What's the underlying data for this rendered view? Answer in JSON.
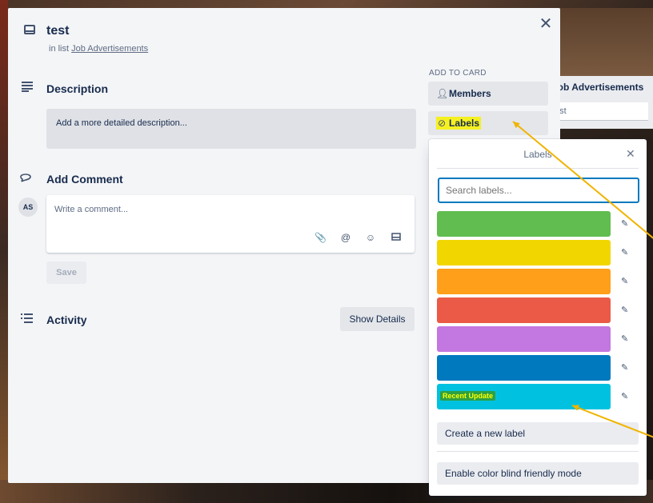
{
  "background": {
    "list_title": "Job Advertisements",
    "card_text": "test"
  },
  "modal": {
    "close_glyph": "✕",
    "card_title": "test",
    "in_list_prefix": "in list",
    "list_link": "Job Advertisements",
    "description": {
      "title": "Description",
      "placeholder": "Add a more detailed description..."
    },
    "comment": {
      "title": "Add Comment",
      "avatar_initials": "AS",
      "placeholder": "Write a comment...",
      "icons": [
        "attachment-icon",
        "mention-icon",
        "emoji-icon",
        "card-icon"
      ],
      "save_label": "Save"
    },
    "activity": {
      "title": "Activity",
      "show_details_label": "Show Details"
    }
  },
  "sidebar": {
    "section_label": "ADD TO CARD",
    "buttons": [
      {
        "label": "Members",
        "icon": "person-icon"
      },
      {
        "label": "Labels",
        "icon": "tag-icon"
      }
    ]
  },
  "labels_popover": {
    "title": "Labels",
    "close_glyph": "✕",
    "search_placeholder": "Search labels...",
    "labels": [
      {
        "color": "#61bd4f",
        "text": ""
      },
      {
        "color": "#f2d600",
        "text": ""
      },
      {
        "color": "#ff9f1a",
        "text": ""
      },
      {
        "color": "#eb5a46",
        "text": ""
      },
      {
        "color": "#c377e0",
        "text": ""
      },
      {
        "color": "#0079bf",
        "text": ""
      },
      {
        "color": "#00c2e0",
        "text": "Recent Update"
      }
    ],
    "create_label": "Create a new label",
    "colorblind_label": "Enable color blind friendly mode"
  },
  "annotation_color": "#f0b400"
}
